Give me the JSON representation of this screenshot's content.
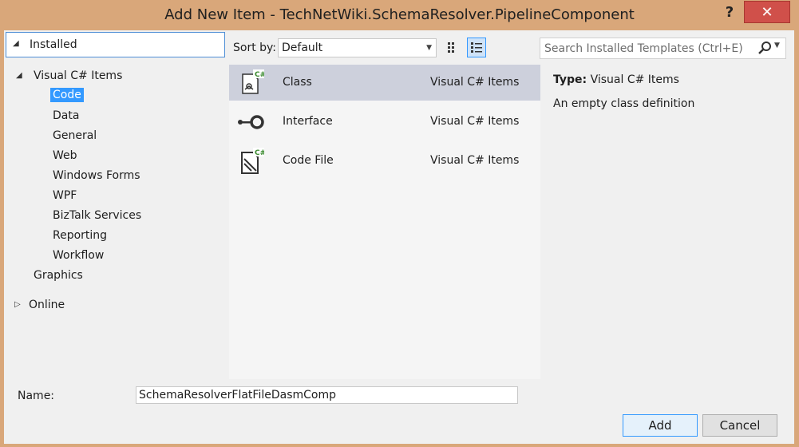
{
  "window": {
    "title": "Add New Item - TechNetWiki.SchemaResolver.PipelineComponent",
    "help_label": "?",
    "close_label": "✕"
  },
  "tree": {
    "installed_label": "Installed",
    "visual_csharp_label": "Visual C# Items",
    "children": [
      "Code",
      "Data",
      "General",
      "Web",
      "Windows Forms",
      "WPF",
      "BizTalk Services",
      "Reporting",
      "Workflow"
    ],
    "graphics_label": "Graphics",
    "online_label": "Online"
  },
  "toolbar": {
    "sort_label": "Sort by:",
    "sort_value": "Default"
  },
  "templates": [
    {
      "name": "Class",
      "category": "Visual C# Items"
    },
    {
      "name": "Interface",
      "category": "Visual C# Items"
    },
    {
      "name": "Code File",
      "category": "Visual C# Items"
    }
  ],
  "search": {
    "placeholder": "Search Installed Templates (Ctrl+E)"
  },
  "details": {
    "type_label": "Type:",
    "type_value": "Visual C# Items",
    "description": "An empty class definition"
  },
  "footer": {
    "name_label": "Name:",
    "name_value": "SchemaResolverFlatFileDasmComp",
    "add_label": "Add",
    "cancel_label": "Cancel"
  },
  "colors": {
    "selection": "#3399ff",
    "selected_row": "#cdd0dc",
    "close_button": "#d0504a",
    "frame": "#d9a77a"
  }
}
